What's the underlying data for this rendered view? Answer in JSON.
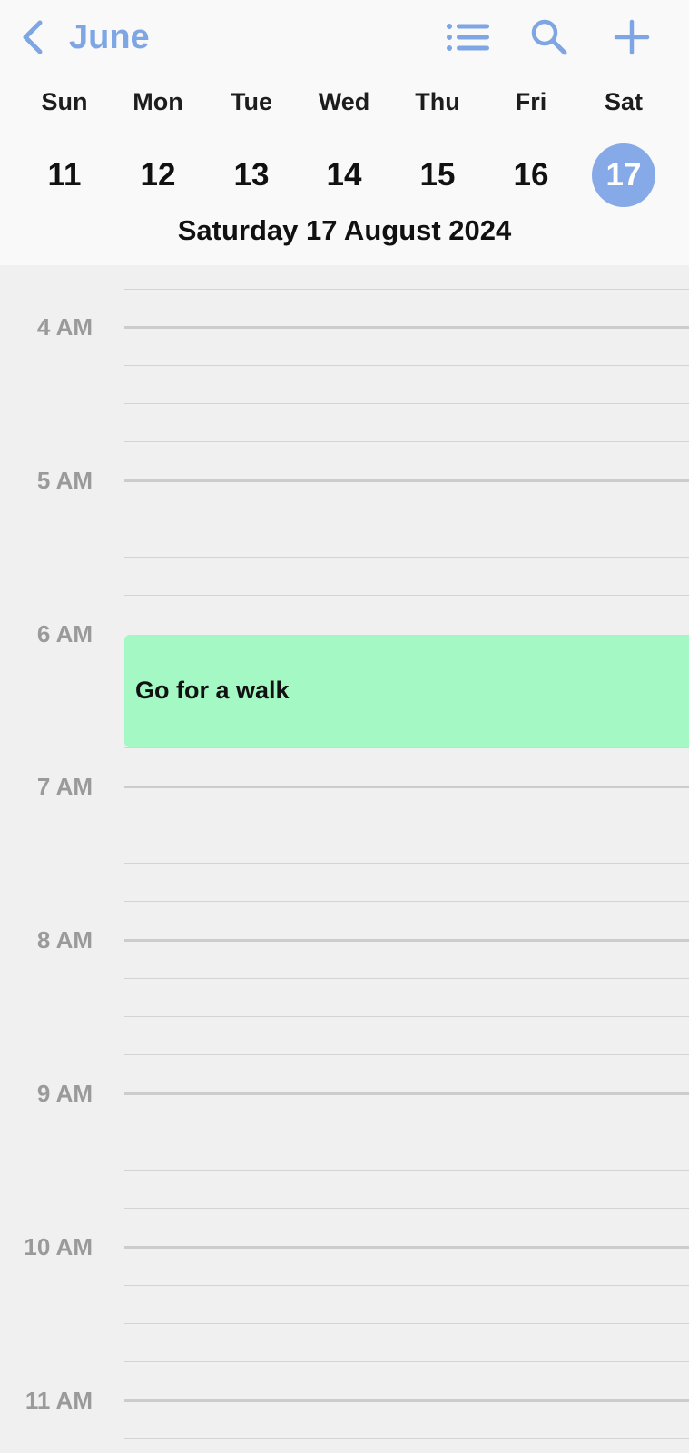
{
  "header": {
    "month": "June",
    "icons": {
      "back": "chevron-left-icon",
      "list": "list-icon",
      "search": "search-icon",
      "add": "plus-icon"
    },
    "accent_color": "#7ea5e4"
  },
  "week": {
    "days": [
      {
        "name": "Sun",
        "num": "11"
      },
      {
        "name": "Mon",
        "num": "12"
      },
      {
        "name": "Tue",
        "num": "13"
      },
      {
        "name": "Wed",
        "num": "14"
      },
      {
        "name": "Thu",
        "num": "15"
      },
      {
        "name": "Fri",
        "num": "16"
      },
      {
        "name": "Sat",
        "num": "17"
      }
    ],
    "selected_day": "17",
    "selected_color": "#86aae7"
  },
  "date_title": "Saturday 17 August 2024",
  "timeline": {
    "hours": [
      "4 AM",
      "5 AM",
      "6 AM",
      "7 AM",
      "8 AM",
      "9 AM",
      "10 AM",
      "11 AM"
    ]
  },
  "events": [
    {
      "title": "Go for a walk",
      "color": "#a3f8c4"
    }
  ]
}
